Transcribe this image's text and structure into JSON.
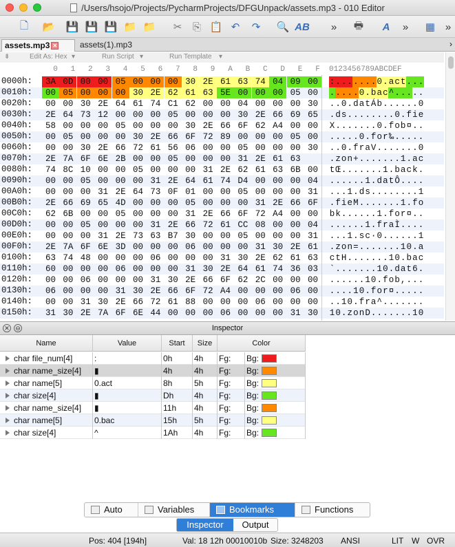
{
  "window": {
    "title": "/Users/hsojo/Projects/PycharmProjects/DFGUnpack/assets.mp3 - 010 Editor"
  },
  "tabs": [
    {
      "label": "assets.mp3",
      "active": true
    },
    {
      "label": "assets(1).mp3",
      "active": false
    }
  ],
  "editor_header": {
    "edit_as": "Edit As: Hex",
    "run_script": "Run Script",
    "run_template": "Run Template"
  },
  "hex_columns": [
    "0",
    "1",
    "2",
    "3",
    "4",
    "5",
    "6",
    "7",
    "8",
    "9",
    "A",
    "B",
    "C",
    "D",
    "E",
    "F"
  ],
  "ascii_header": "0123456789ABCDEF",
  "highlight_colors": {
    "red": "#ee1c1c",
    "orange": "#ff8800",
    "yellow": "#ffff80",
    "green": "#66e61e"
  },
  "hex_rows": [
    {
      "addr": "0000h:",
      "bytes": [
        "3A",
        "0D",
        "00",
        "00",
        "05",
        "00",
        "00",
        "00",
        "30",
        "2E",
        "61",
        "63",
        "74",
        "04",
        "09",
        "00"
      ],
      "ascii": ":...‌....0.act..."
    },
    {
      "addr": "0010h:",
      "bytes": [
        "00",
        "05",
        "00",
        "00",
        "00",
        "30",
        "2E",
        "62",
        "61",
        "63",
        "5E",
        "00",
        "00",
        "00",
        "05",
        "00"
      ],
      "ascii": ".....0.bac^....."
    },
    {
      "addr": "0020h:",
      "bytes": [
        "00",
        "00",
        "30",
        "2E",
        "64",
        "61",
        "74",
        "C1",
        "62",
        "00",
        "00",
        "04",
        "00",
        "00",
        "00",
        "30"
      ],
      "ascii": "..0.datÁb......0"
    },
    {
      "addr": "0030h:",
      "bytes": [
        "2E",
        "64",
        "73",
        "12",
        "00",
        "00",
        "00",
        "05",
        "00",
        "00",
        "00",
        "30",
        "2E",
        "66",
        "69",
        "65"
      ],
      "ascii": ".ds........0.fie"
    },
    {
      "addr": "0040h:",
      "bytes": [
        "58",
        "00",
        "00",
        "00",
        "05",
        "00",
        "00",
        "00",
        "30",
        "2E",
        "66",
        "6F",
        "62",
        "A4",
        "00",
        "00"
      ],
      "ascii": "X.......0.fob¤.."
    },
    {
      "addr": "0050h:",
      "bytes": [
        "00",
        "05",
        "00",
        "00",
        "00",
        "30",
        "2E",
        "66",
        "6F",
        "72",
        "89",
        "00",
        "00",
        "00",
        "05",
        "00"
      ],
      "ascii": ".....0.for‰....."
    },
    {
      "addr": "0060h:",
      "bytes": [
        "00",
        "00",
        "30",
        "2E",
        "66",
        "72",
        "61",
        "56",
        "06",
        "00",
        "00",
        "05",
        "00",
        "00",
        "00",
        "30"
      ],
      "ascii": "..0.fraV.......0"
    },
    {
      "addr": "0070h:",
      "bytes": [
        "2E",
        "7A",
        "6F",
        "6E",
        "2B",
        "00",
        "00",
        "05",
        "00",
        "00",
        "00",
        "31",
        "2E",
        "61",
        "63"
      ],
      "ascii": ".zon+.......1.ac"
    },
    {
      "addr": "0080h:",
      "bytes": [
        "74",
        "8C",
        "10",
        "00",
        "00",
        "05",
        "00",
        "00",
        "00",
        "31",
        "2E",
        "62",
        "61",
        "63",
        "6B",
        "00"
      ],
      "ascii": "tŒ.......1.back."
    },
    {
      "addr": "0090h:",
      "bytes": [
        "00",
        "00",
        "05",
        "00",
        "00",
        "00",
        "31",
        "2E",
        "64",
        "61",
        "74",
        "D4",
        "00",
        "00",
        "00",
        "04"
      ],
      "ascii": "......1.datÔ...."
    },
    {
      "addr": "00A0h:",
      "bytes": [
        "00",
        "00",
        "00",
        "31",
        "2E",
        "64",
        "73",
        "0F",
        "01",
        "00",
        "00",
        "05",
        "00",
        "00",
        "00",
        "31"
      ],
      "ascii": "...1.ds........1"
    },
    {
      "addr": "00B0h:",
      "bytes": [
        "2E",
        "66",
        "69",
        "65",
        "4D",
        "00",
        "00",
        "00",
        "05",
        "00",
        "00",
        "00",
        "31",
        "2E",
        "66",
        "6F"
      ],
      "ascii": ".fieM.......1.fo"
    },
    {
      "addr": "00C0h:",
      "bytes": [
        "62",
        "6B",
        "00",
        "00",
        "05",
        "00",
        "00",
        "00",
        "31",
        "2E",
        "66",
        "6F",
        "72",
        "A4",
        "00",
        "00"
      ],
      "ascii": "bk......1.for¤.."
    },
    {
      "addr": "00D0h:",
      "bytes": [
        "00",
        "00",
        "05",
        "00",
        "00",
        "00",
        "31",
        "2E",
        "66",
        "72",
        "61",
        "CC",
        "08",
        "00",
        "00",
        "04"
      ],
      "ascii": "......1.fraÌ...."
    },
    {
      "addr": "00E0h:",
      "bytes": [
        "00",
        "00",
        "00",
        "31",
        "2E",
        "73",
        "63",
        "B7",
        "30",
        "00",
        "00",
        "05",
        "00",
        "00",
        "00",
        "31"
      ],
      "ascii": "...1.sc·0......1"
    },
    {
      "addr": "00F0h:",
      "bytes": [
        "2E",
        "7A",
        "6F",
        "6E",
        "3D",
        "00",
        "00",
        "00",
        "06",
        "00",
        "00",
        "00",
        "31",
        "30",
        "2E",
        "61"
      ],
      "ascii": ".zon=.......10.a"
    },
    {
      "addr": "0100h:",
      "bytes": [
        "63",
        "74",
        "48",
        "00",
        "00",
        "00",
        "06",
        "00",
        "00",
        "00",
        "31",
        "30",
        "2E",
        "62",
        "61",
        "63"
      ],
      "ascii": "ctH.......10.bac"
    },
    {
      "addr": "0110h:",
      "bytes": [
        "60",
        "00",
        "00",
        "00",
        "06",
        "00",
        "00",
        "00",
        "31",
        "30",
        "2E",
        "64",
        "61",
        "74",
        "36",
        "03"
      ],
      "ascii": "`.......10.dat6."
    },
    {
      "addr": "0120h:",
      "bytes": [
        "00",
        "00",
        "06",
        "00",
        "00",
        "00",
        "31",
        "30",
        "2E",
        "66",
        "6F",
        "62",
        "2C",
        "00",
        "00",
        "00"
      ],
      "ascii": "......10.fob,..."
    },
    {
      "addr": "0130h:",
      "bytes": [
        "06",
        "00",
        "00",
        "00",
        "31",
        "30",
        "2E",
        "66",
        "6F",
        "72",
        "A4",
        "00",
        "00",
        "00",
        "06",
        "00"
      ],
      "ascii": "....10.for¤....."
    },
    {
      "addr": "0140h:",
      "bytes": [
        "00",
        "00",
        "31",
        "30",
        "2E",
        "66",
        "72",
        "61",
        "88",
        "00",
        "00",
        "00",
        "06",
        "00",
        "00",
        "00"
      ],
      "ascii": "..10.fra^......."
    },
    {
      "addr": "0150h:",
      "bytes": [
        "31",
        "30",
        "2E",
        "7A",
        "6F",
        "6E",
        "44",
        "00",
        "00",
        "00",
        "06",
        "00",
        "00",
        "00",
        "31",
        "30"
      ],
      "ascii": "10.zonD.......10"
    }
  ],
  "inspector": {
    "title": "Inspector",
    "columns": [
      "Name",
      "Value",
      "Start",
      "Size",
      "Color"
    ],
    "rows": [
      {
        "name": "char file_num[4]",
        "value": ":",
        "start": "0h",
        "size": "4h",
        "fg": "Fg:",
        "bg": "Bg:",
        "bg_color": "#ee1c1c"
      },
      {
        "name": "char name_size[4]",
        "value": "▮",
        "start": "4h",
        "size": "4h",
        "fg": "Fg:",
        "bg": "Bg:",
        "bg_color": "#ff8800"
      },
      {
        "name": "char name[5]",
        "value": "0.act",
        "start": "8h",
        "size": "5h",
        "fg": "Fg:",
        "bg": "Bg:",
        "bg_color": "#ffff80"
      },
      {
        "name": "char size[4]",
        "value": "▮",
        "start": "Dh",
        "size": "4h",
        "fg": "Fg:",
        "bg": "Bg:",
        "bg_color": "#66e61e"
      },
      {
        "name": "char name_size[4]",
        "value": "▮",
        "start": "11h",
        "size": "4h",
        "fg": "Fg:",
        "bg": "Bg:",
        "bg_color": "#ff8800"
      },
      {
        "name": "char name[5]",
        "value": "0.bac",
        "start": "15h",
        "size": "5h",
        "fg": "Fg:",
        "bg": "Bg:",
        "bg_color": "#ffff80"
      },
      {
        "name": "char size[4]",
        "value": "^",
        "start": "1Ah",
        "size": "4h",
        "fg": "Fg:",
        "bg": "Bg:",
        "bg_color": "#66e61e"
      }
    ]
  },
  "bottom_tabs": [
    "Auto",
    "Variables",
    "Bookmarks",
    "Functions"
  ],
  "bottom_tabs_active": "Bookmarks",
  "panel_tabs": [
    "Inspector",
    "Output"
  ],
  "status": {
    "pos": "Pos: 404 [194h]",
    "val": "Val: 18 12h 00010010b",
    "size": "Size: 3248203",
    "encoding": "ANSI",
    "lit": "LIT",
    "w": "W",
    "ovr": "OVR"
  }
}
